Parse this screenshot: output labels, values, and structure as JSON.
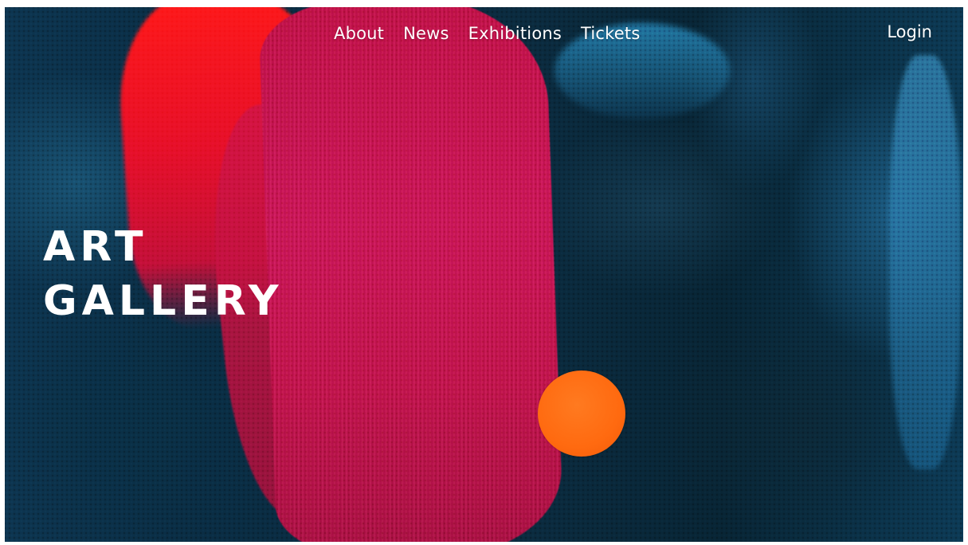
{
  "nav": {
    "items": [
      {
        "label": "About"
      },
      {
        "label": "News"
      },
      {
        "label": "Exhibitions"
      },
      {
        "label": "Tickets"
      }
    ],
    "login_label": "Login"
  },
  "hero": {
    "title_line1": "ART",
    "title_line2": "GALLERY"
  },
  "colors": {
    "text": "#ffffff",
    "accent_orange": "#ff6a10",
    "paint_red": "#e8102a",
    "paint_magenta": "#d2145a",
    "paint_blue": "#0b2a3a"
  }
}
